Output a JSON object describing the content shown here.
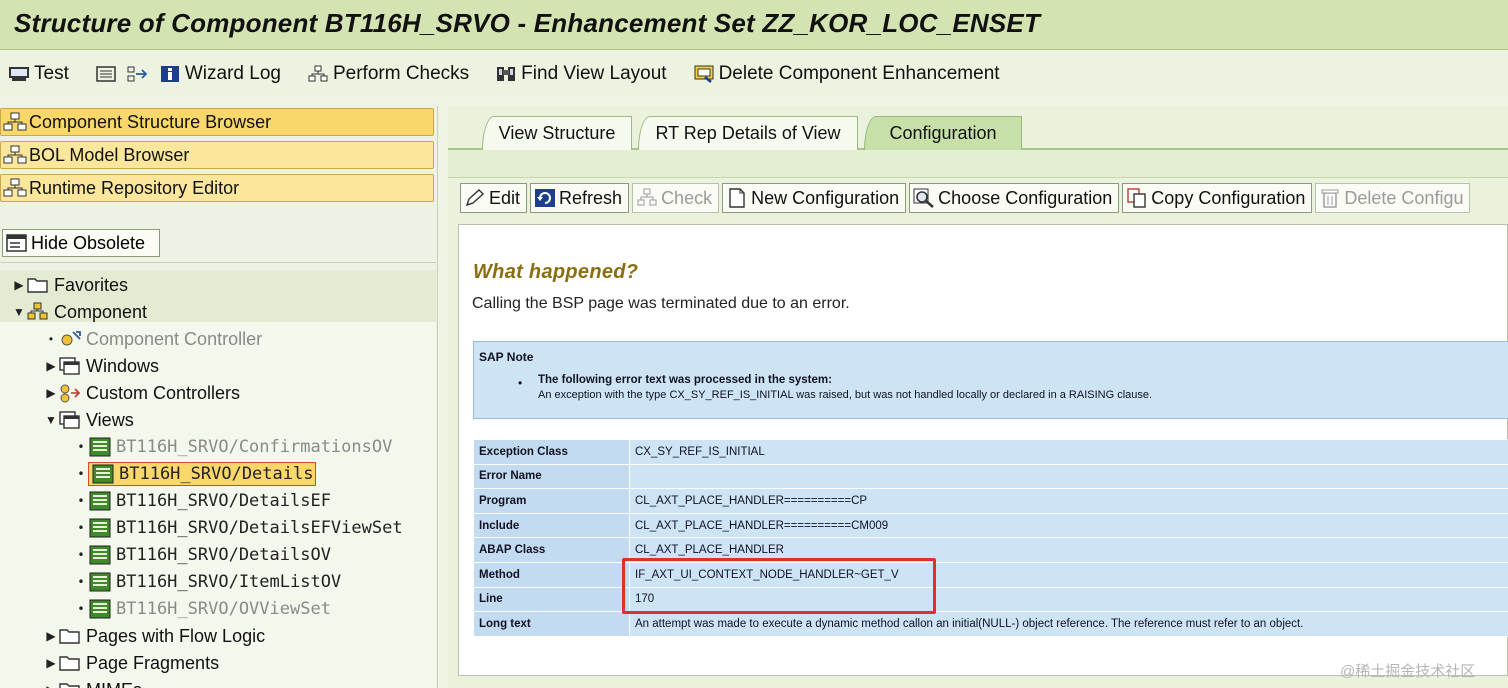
{
  "title": "Structure of Component BT116H_SRVO - Enhancement Set ZZ_KOR_LOC_ENSET",
  "toolbar": {
    "test": "Test",
    "wizard_log": "Wizard Log",
    "perform_checks": "Perform Checks",
    "find_view_layout": "Find View Layout",
    "delete_component_enhancement": "Delete Component Enhancement"
  },
  "left": {
    "browsers": [
      "Component Structure Browser",
      "BOL Model Browser",
      "Runtime Repository Editor"
    ],
    "hide_obsolete": "Hide Obsolete",
    "tree": {
      "favorites": "Favorites",
      "component": "Component",
      "component_controller": "Component Controller",
      "windows": "Windows",
      "custom_controllers": "Custom Controllers",
      "views": "Views",
      "view_items": [
        "BT116H_SRVO/ConfirmationsOV",
        "BT116H_SRVO/Details",
        "BT116H_SRVO/DetailsEF",
        "BT116H_SRVO/DetailsEFViewSet",
        "BT116H_SRVO/DetailsOV",
        "BT116H_SRVO/ItemListOV",
        "BT116H_SRVO/OVViewSet"
      ],
      "pages_with_flow_logic": "Pages with Flow Logic",
      "page_fragments": "Page Fragments",
      "mimes": "MIMEs"
    }
  },
  "right": {
    "tabs": [
      "View Structure",
      "RT Rep Details of View",
      "Configuration"
    ],
    "active_tab": "Configuration",
    "config_buttons": {
      "edit": "Edit",
      "refresh": "Refresh",
      "check": "Check",
      "new_configuration": "New Configuration",
      "choose_configuration": "Choose Configuration",
      "copy_configuration": "Copy Configuration",
      "delete_configuration": "Delete Configu"
    },
    "error": {
      "heading": "What happened?",
      "summary": "Calling the BSP page was terminated due to an error.",
      "sap_note_label": "SAP Note",
      "sap_note_bullet": "The following error text was processed in the system:",
      "sap_note_detail": "An exception with the type CX_SY_REF_IS_INITIAL was raised, but was not handled locally or declared in a RAISING clause.",
      "rows": [
        {
          "key": "Exception Class",
          "value": "CX_SY_REF_IS_INITIAL"
        },
        {
          "key": "Error Name",
          "value": ""
        },
        {
          "key": "Program",
          "value": "CL_AXT_PLACE_HANDLER==========CP"
        },
        {
          "key": "Include",
          "value": "CL_AXT_PLACE_HANDLER==========CM009"
        },
        {
          "key": "ABAP Class",
          "value": "CL_AXT_PLACE_HANDLER"
        },
        {
          "key": "Method",
          "value": "IF_AXT_UI_CONTEXT_NODE_HANDLER~GET_V"
        },
        {
          "key": "Line",
          "value": "170"
        },
        {
          "key": "Long text",
          "value": "An attempt was made to execute a dynamic method callon an initial(NULL-) object reference. The reference must refer to an object."
        }
      ]
    }
  },
  "watermark": "@稀土掘金技术社区",
  "colors": {
    "title_bg": "#d4e3b2",
    "browser_button": "#fbe79b",
    "selected_node": "#f9d76b",
    "note_blue": "#cde4f6",
    "heading_gold": "#8a6f12",
    "highlight_red": "#e0302a"
  }
}
